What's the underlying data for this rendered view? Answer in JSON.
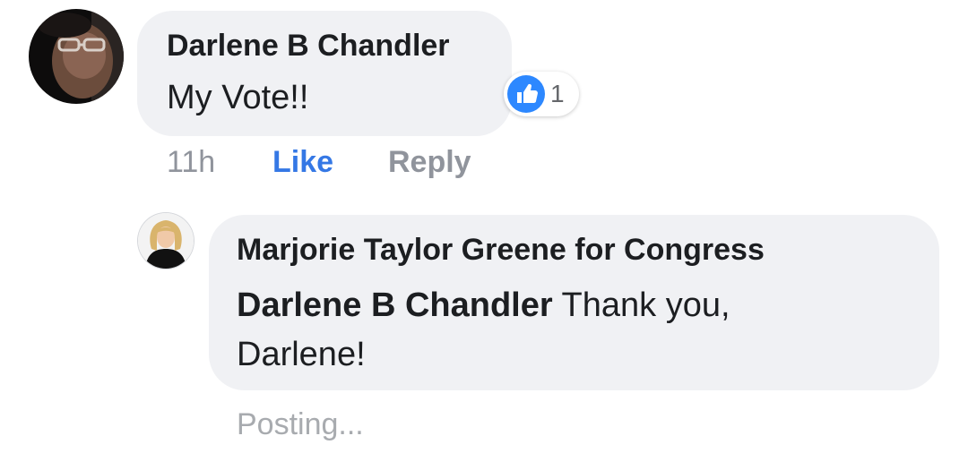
{
  "comment": {
    "author": "Darlene B Chandler",
    "text": "My Vote!!",
    "reactions": {
      "icon": "like-icon",
      "count": "1",
      "color": "#2d88ff"
    },
    "actions": {
      "time": "11h",
      "like": "Like",
      "reply": "Reply"
    }
  },
  "reply": {
    "author": "Marjorie Taylor Greene for Congress",
    "mention": "Darlene B Chandler",
    "text_line1": "Thank you,",
    "text_line2": "Darlene!",
    "status": "Posting..."
  },
  "colors": {
    "bubble": "#f0f1f4",
    "text": "#1c1e21",
    "link": "#3578e5",
    "muted": "#90949c"
  }
}
